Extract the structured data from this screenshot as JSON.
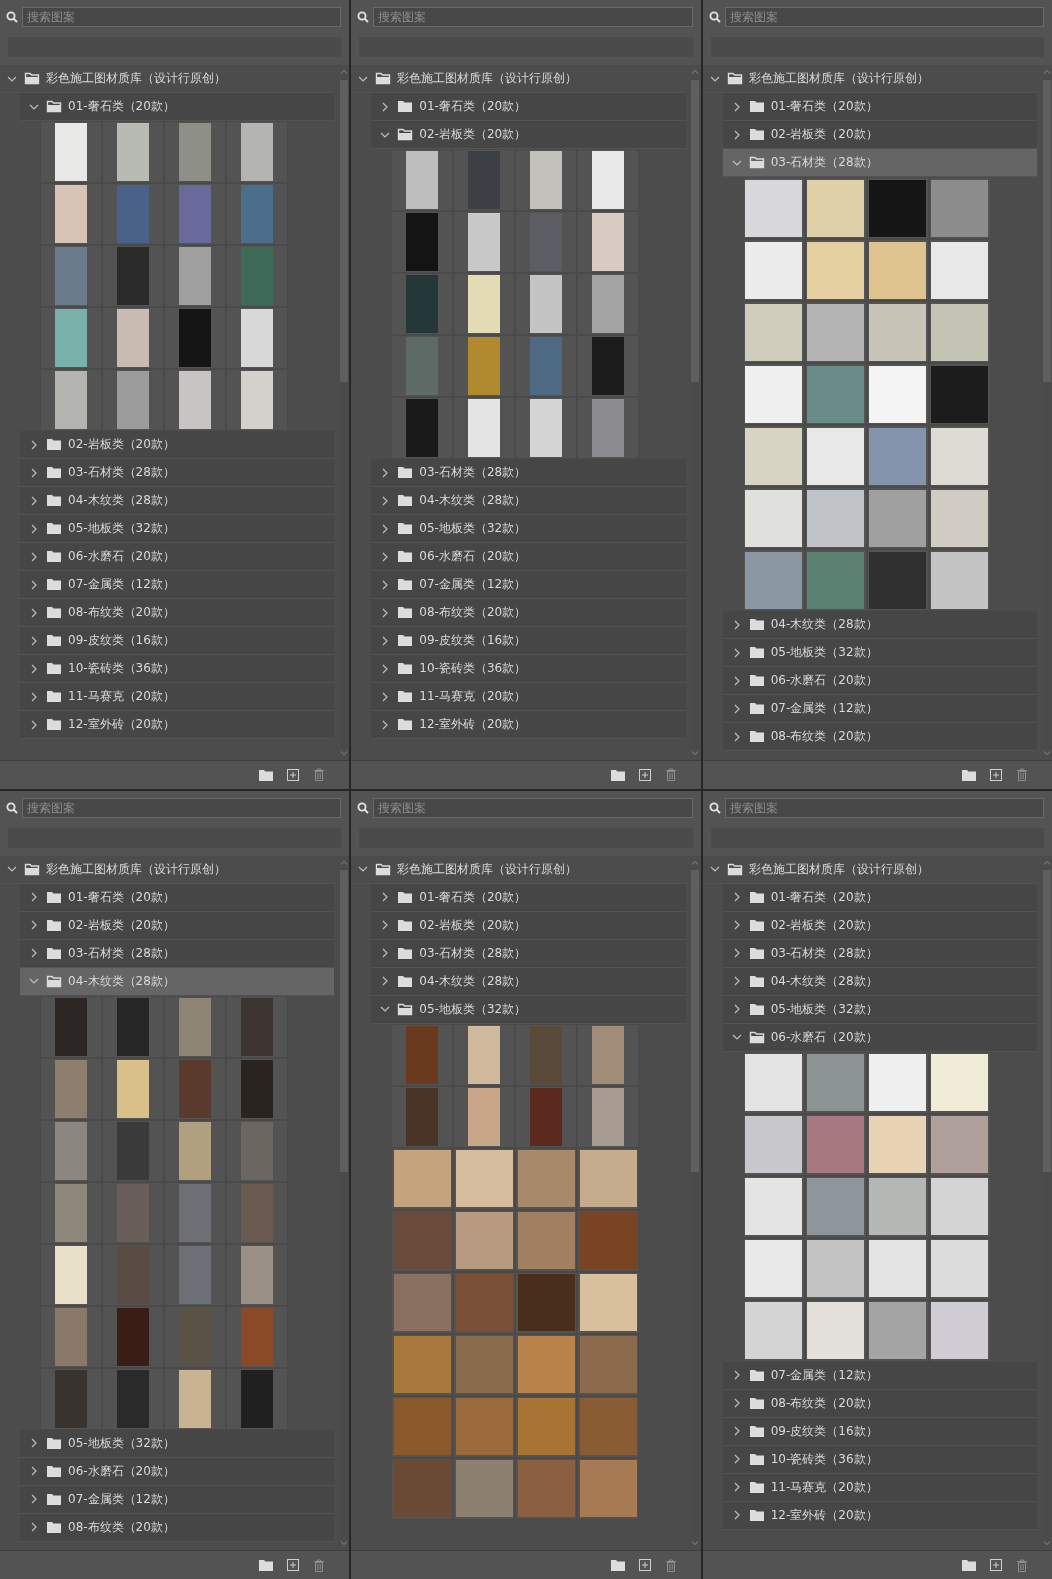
{
  "panels": [
    {
      "search": {
        "placeholder": "搜索图案"
      },
      "tree": {
        "label": "彩色施工图材质库（设计行原创）",
        "expanded": true,
        "children": [
          {
            "label": "01-奢石类（20款）",
            "expanded": true,
            "selected": false,
            "swatch_rows": [
              {
                "kind": "portrait",
                "swatches": [
                  {
                    "color": "#e8e8e6"
                  },
                  {
                    "color": "#b8bab4"
                  },
                  {
                    "color": "#8e9088"
                  },
                  {
                    "color": "#b4b4b0"
                  }
                ]
              },
              {
                "kind": "portrait",
                "swatches": [
                  {
                    "color": "#d8c4b4"
                  },
                  {
                    "color": "#4a6288"
                  },
                  {
                    "color": "#6a6a9a"
                  },
                  {
                    "color": "#4a6e8c"
                  }
                ]
              },
              {
                "kind": "portrait",
                "swatches": [
                  {
                    "color": "#6a7c8c"
                  },
                  {
                    "color": "#2a2a2a"
                  },
                  {
                    "color": "#a0a0a0"
                  },
                  {
                    "color": "#3e6a58"
                  }
                ]
              },
              {
                "kind": "portrait",
                "swatches": [
                  {
                    "color": "#7ab0aa"
                  },
                  {
                    "color": "#c8bcb0"
                  },
                  {
                    "color": "#151515"
                  },
                  {
                    "color": "#d8d8d8"
                  }
                ]
              },
              {
                "kind": "portrait",
                "swatches": [
                  {
                    "color": "#b4b4b0"
                  },
                  {
                    "color": "#9c9c9c"
                  },
                  {
                    "color": "#c8c4c4"
                  },
                  {
                    "color": "#d4d0cc"
                  }
                ]
              }
            ]
          },
          {
            "label": "02-岩板类（20款）",
            "expanded": false,
            "selected": false
          },
          {
            "label": "03-石材类（28款）",
            "expanded": false,
            "selected": false
          },
          {
            "label": "04-木纹类（28款）",
            "expanded": false,
            "selected": false
          },
          {
            "label": "05-地板类（32款）",
            "expanded": false,
            "selected": false
          },
          {
            "label": "06-水磨石（20款）",
            "expanded": false,
            "selected": false
          },
          {
            "label": "07-金属类（12款）",
            "expanded": false,
            "selected": false
          },
          {
            "label": "08-布纹类（20款）",
            "expanded": false,
            "selected": false
          },
          {
            "label": "09-皮纹类（16款）",
            "expanded": false,
            "selected": false
          },
          {
            "label": "10-瓷砖类（36款）",
            "expanded": false,
            "selected": false
          },
          {
            "label": "11-马赛克（20款）",
            "expanded": false,
            "selected": false
          },
          {
            "label": "12-室外砖（20款）",
            "expanded": false,
            "selected": false
          }
        ]
      }
    },
    {
      "search": {
        "placeholder": "搜索图案"
      },
      "tree": {
        "label": "彩色施工图材质库（设计行原创）",
        "expanded": true,
        "children": [
          {
            "label": "01-奢石类（20款）",
            "expanded": false,
            "selected": false
          },
          {
            "label": "02-岩板类（20款）",
            "expanded": true,
            "selected": false,
            "swatch_rows": [
              {
                "kind": "portrait",
                "swatches": [
                  {
                    "color": "#bebebe"
                  },
                  {
                    "color": "#3c4044"
                  },
                  {
                    "color": "#c2c0ba"
                  },
                  {
                    "color": "#e8e8e8"
                  }
                ]
              },
              {
                "kind": "portrait",
                "swatches": [
                  {
                    "color": "#141414"
                  },
                  {
                    "color": "#c8c8c8"
                  },
                  {
                    "color": "#5c5c64"
                  },
                  {
                    "color": "#d8ccc4"
                  }
                ]
              },
              {
                "kind": "portrait",
                "swatches": [
                  {
                    "color": "#24383a"
                  },
                  {
                    "color": "#e4dcb4"
                  },
                  {
                    "color": "#c4c4c4"
                  },
                  {
                    "color": "#a4a4a4"
                  }
                ]
              },
              {
                "kind": "portrait",
                "swatches": [
                  {
                    "color": "#5e6a66"
                  },
                  {
                    "color": "#b08a2c"
                  },
                  {
                    "color": "#4e6a82"
                  },
                  {
                    "color": "#1c1c1c"
                  }
                ]
              },
              {
                "kind": "portrait",
                "swatches": [
                  {
                    "color": "#1a1a1a"
                  },
                  {
                    "color": "#e4e4e4"
                  },
                  {
                    "color": "#d4d4d4"
                  },
                  {
                    "color": "#8c8c90"
                  }
                ]
              }
            ]
          },
          {
            "label": "03-石材类（28款）",
            "expanded": false,
            "selected": false
          },
          {
            "label": "04-木纹类（28款）",
            "expanded": false,
            "selected": false
          },
          {
            "label": "05-地板类（32款）",
            "expanded": false,
            "selected": false
          },
          {
            "label": "06-水磨石（20款）",
            "expanded": false,
            "selected": false
          },
          {
            "label": "07-金属类（12款）",
            "expanded": false,
            "selected": false
          },
          {
            "label": "08-布纹类（20款）",
            "expanded": false,
            "selected": false
          },
          {
            "label": "09-皮纹类（16款）",
            "expanded": false,
            "selected": false
          },
          {
            "label": "10-瓷砖类（36款）",
            "expanded": false,
            "selected": false
          },
          {
            "label": "11-马赛克（20款）",
            "expanded": false,
            "selected": false
          },
          {
            "label": "12-室外砖（20款）",
            "expanded": false,
            "selected": false
          }
        ]
      }
    },
    {
      "search": {
        "placeholder": "搜索图案"
      },
      "tree": {
        "label": "彩色施工图材质库（设计行原创）",
        "expanded": true,
        "children": [
          {
            "label": "01-奢石类（20款）",
            "expanded": false,
            "selected": false
          },
          {
            "label": "02-岩板类（20款）",
            "expanded": false,
            "selected": false
          },
          {
            "label": "03-石材类（28款）",
            "expanded": true,
            "selected": true,
            "swatch_rows": [
              {
                "kind": "square",
                "swatches": [
                  {
                    "color": "#d8d8dc"
                  },
                  {
                    "color": "#e0d0a8"
                  },
                  {
                    "color": "#151515"
                  },
                  {
                    "color": "#8c8c8c"
                  }
                ]
              },
              {
                "kind": "square",
                "swatches": [
                  {
                    "color": "#ececec"
                  },
                  {
                    "color": "#e4d0a0"
                  },
                  {
                    "color": "#e0c490"
                  },
                  {
                    "color": "#e8e8e8"
                  }
                ]
              },
              {
                "kind": "square",
                "swatches": [
                  {
                    "color": "#d0ccbc"
                  },
                  {
                    "color": "#b4b4b4"
                  },
                  {
                    "color": "#c8c4b8"
                  },
                  {
                    "color": "#c4c4b4"
                  }
                ]
              },
              {
                "kind": "square",
                "swatches": [
                  {
                    "color": "#f0f0f0"
                  },
                  {
                    "color": "#6a8c88"
                  },
                  {
                    "color": "#f4f4f4"
                  },
                  {
                    "color": "#1c1c1c"
                  }
                ]
              },
              {
                "kind": "square",
                "swatches": [
                  {
                    "color": "#d8d4c4"
                  },
                  {
                    "color": "#e8e8e8"
                  },
                  {
                    "color": "#8494ac"
                  },
                  {
                    "color": "#dcdcd4"
                  }
                ]
              },
              {
                "kind": "square",
                "swatches": [
                  {
                    "color": "#e0e0dc"
                  },
                  {
                    "color": "#c0c4c8"
                  },
                  {
                    "color": "#a0a0a0"
                  },
                  {
                    "color": "#d0ccc4"
                  }
                ]
              },
              {
                "kind": "square",
                "swatches": [
                  {
                    "color": "#8a96a0"
                  },
                  {
                    "color": "#5a8070"
                  },
                  {
                    "color": "#303030"
                  },
                  {
                    "color": "#c4c4c4"
                  }
                ]
              }
            ]
          },
          {
            "label": "04-木纹类（28款）",
            "expanded": false,
            "selected": false
          },
          {
            "label": "05-地板类（32款）",
            "expanded": false,
            "selected": false
          },
          {
            "label": "06-水磨石（20款）",
            "expanded": false,
            "selected": false
          },
          {
            "label": "07-金属类（12款）",
            "expanded": false,
            "selected": false
          },
          {
            "label": "08-布纹类（20款）",
            "expanded": false,
            "selected": false
          }
        ]
      }
    },
    {
      "search": {
        "placeholder": "搜索图案"
      },
      "tree": {
        "label": "彩色施工图材质库（设计行原创）",
        "expanded": true,
        "children": [
          {
            "label": "01-奢石类（20款）",
            "expanded": false,
            "selected": false
          },
          {
            "label": "02-岩板类（20款）",
            "expanded": false,
            "selected": false
          },
          {
            "label": "03-石材类（28款）",
            "expanded": false,
            "selected": false
          },
          {
            "label": "04-木纹类（28款）",
            "expanded": true,
            "selected": true,
            "swatch_rows": [
              {
                "kind": "portrait",
                "swatches": [
                  {
                    "color": "#2c2624"
                  },
                  {
                    "color": "#262626"
                  },
                  {
                    "color": "#8e8474"
                  },
                  {
                    "color": "#3e3432"
                  }
                ]
              },
              {
                "kind": "portrait",
                "swatches": [
                  {
                    "color": "#8e7e6e"
                  },
                  {
                    "color": "#d8c088"
                  },
                  {
                    "color": "#5a3a2c"
                  },
                  {
                    "color": "#2a2420"
                  }
                ]
              },
              {
                "kind": "portrait",
                "swatches": [
                  {
                    "color": "#8c8680"
                  },
                  {
                    "color": "#3a3a3a"
                  },
                  {
                    "color": "#b0a080"
                  },
                  {
                    "color": "#6c6660"
                  }
                ]
              },
              {
                "kind": "portrait",
                "swatches": [
                  {
                    "color": "#8e887a"
                  },
                  {
                    "color": "#6a5e58"
                  },
                  {
                    "color": "#6e7076"
                  },
                  {
                    "color": "#6a5a50"
                  }
                ]
              },
              {
                "kind": "portrait",
                "swatches": [
                  {
                    "color": "#e8e0c8"
                  },
                  {
                    "color": "#5a4c44"
                  },
                  {
                    "color": "#6e7078"
                  },
                  {
                    "color": "#9a9088"
                  }
                ]
              },
              {
                "kind": "portrait",
                "swatches": [
                  {
                    "color": "#8a7868"
                  },
                  {
                    "color": "#3a1e16"
                  },
                  {
                    "color": "#5a5244"
                  },
                  {
                    "color": "#8a4a28"
                  }
                ]
              },
              {
                "kind": "portrait",
                "swatches": [
                  {
                    "color": "#3a3430"
                  },
                  {
                    "color": "#2a2a2a"
                  },
                  {
                    "color": "#c8b490"
                  },
                  {
                    "color": "#202020"
                  }
                ]
              }
            ]
          },
          {
            "label": "05-地板类（32款）",
            "expanded": false,
            "selected": false
          },
          {
            "label": "06-水磨石（20款）",
            "expanded": false,
            "selected": false
          },
          {
            "label": "07-金属类（12款）",
            "expanded": false,
            "selected": false
          },
          {
            "label": "08-布纹类（20款）",
            "expanded": false,
            "selected": false
          }
        ]
      }
    },
    {
      "search": {
        "placeholder": "搜索图案"
      },
      "tree": {
        "label": "彩色施工图材质库（设计行原创）",
        "expanded": true,
        "children": [
          {
            "label": "01-奢石类（20款）",
            "expanded": false,
            "selected": false
          },
          {
            "label": "02-岩板类（20款）",
            "expanded": false,
            "selected": false
          },
          {
            "label": "03-石材类（28款）",
            "expanded": false,
            "selected": false
          },
          {
            "label": "04-木纹类（28款）",
            "expanded": false,
            "selected": false
          },
          {
            "label": "05-地板类（32款）",
            "expanded": true,
            "selected": false,
            "swatch_rows": [
              {
                "kind": "portrait",
                "swatches": [
                  {
                    "color": "#6a3a1e"
                  },
                  {
                    "color": "#d0b89c"
                  },
                  {
                    "color": "#5a4a3a"
                  },
                  {
                    "color": "#a08c78"
                  }
                ]
              },
              {
                "kind": "portrait",
                "swatches": [
                  {
                    "color": "#4a3428"
                  },
                  {
                    "color": "#c8a888"
                  },
                  {
                    "color": "#5a2a1e"
                  },
                  {
                    "color": "#a89c90"
                  }
                ]
              },
              {
                "kind": "square",
                "swatches": [
                  {
                    "color": "#c4a47c"
                  },
                  {
                    "color": "#d4bc9c"
                  },
                  {
                    "color": "#a88a6a"
                  },
                  {
                    "color": "#c4ac8c"
                  }
                ]
              },
              {
                "kind": "square",
                "swatches": [
                  {
                    "color": "#6a4a3a"
                  },
                  {
                    "color": "#b89a80"
                  },
                  {
                    "color": "#a08060"
                  },
                  {
                    "color": "#7a4424"
                  }
                ]
              },
              {
                "kind": "square",
                "swatches": [
                  {
                    "color": "#8a7060"
                  },
                  {
                    "color": "#7a5036"
                  },
                  {
                    "color": "#4a2e1c"
                  },
                  {
                    "color": "#d8c09c"
                  }
                ]
              },
              {
                "kind": "square",
                "swatches": [
                  {
                    "color": "#a8783c"
                  },
                  {
                    "color": "#8a6c4c"
                  },
                  {
                    "color": "#b8844c"
                  },
                  {
                    "color": "#8c6a4c"
                  }
                ]
              },
              {
                "kind": "square",
                "swatches": [
                  {
                    "color": "#8a5a2c"
                  },
                  {
                    "color": "#9a6a3c"
                  },
                  {
                    "color": "#a87434"
                  },
                  {
                    "color": "#8a5c34"
                  }
                ]
              },
              {
                "kind": "square",
                "swatches": [
                  {
                    "color": "#6a4a34"
                  },
                  {
                    "color": "#8c8070"
                  },
                  {
                    "color": "#8a6040"
                  },
                  {
                    "color": "#a87a54"
                  }
                ]
              }
            ]
          }
        ]
      }
    },
    {
      "search": {
        "placeholder": "搜索图案"
      },
      "tree": {
        "label": "彩色施工图材质库（设计行原创）",
        "expanded": true,
        "children": [
          {
            "label": "01-奢石类（20款）",
            "expanded": false,
            "selected": false
          },
          {
            "label": "02-岩板类（20款）",
            "expanded": false,
            "selected": false
          },
          {
            "label": "03-石材类（28款）",
            "expanded": false,
            "selected": false
          },
          {
            "label": "04-木纹类（28款）",
            "expanded": false,
            "selected": false
          },
          {
            "label": "05-地板类（32款）",
            "expanded": false,
            "selected": false
          },
          {
            "label": "06-水磨石（20款）",
            "expanded": true,
            "selected": false,
            "swatch_rows": [
              {
                "kind": "square",
                "swatches": [
                  {
                    "color": "#e4e4e4"
                  },
                  {
                    "color": "#8c9494"
                  },
                  {
                    "color": "#f0f0f0"
                  },
                  {
                    "color": "#f0ecd8"
                  }
                ]
              },
              {
                "kind": "square",
                "swatches": [
                  {
                    "color": "#c8c8cc"
                  },
                  {
                    "color": "#a87880"
                  },
                  {
                    "color": "#e8d4b4"
                  },
                  {
                    "color": "#b0a09c"
                  }
                ]
              },
              {
                "kind": "square",
                "swatches": [
                  {
                    "color": "#e4e4e4"
                  },
                  {
                    "color": "#8e969c"
                  },
                  {
                    "color": "#b4b8b4"
                  },
                  {
                    "color": "#d4d4d4"
                  }
                ]
              },
              {
                "kind": "square",
                "swatches": [
                  {
                    "color": "#e8e8e8"
                  },
                  {
                    "color": "#c4c4c4"
                  },
                  {
                    "color": "#e4e4e4"
                  },
                  {
                    "color": "#dcdcdc"
                  }
                ]
              },
              {
                "kind": "square",
                "swatches": [
                  {
                    "color": "#d4d4d4"
                  },
                  {
                    "color": "#e4e0dc"
                  },
                  {
                    "color": "#a4a4a4"
                  },
                  {
                    "color": "#d0ccd4"
                  }
                ]
              }
            ]
          },
          {
            "label": "07-金属类（12款）",
            "expanded": false,
            "selected": false
          },
          {
            "label": "08-布纹类（20款）",
            "expanded": false,
            "selected": false
          },
          {
            "label": "09-皮纹类（16款）",
            "expanded": false,
            "selected": false
          },
          {
            "label": "10-瓷砖类（36款）",
            "expanded": false,
            "selected": false
          },
          {
            "label": "11-马赛克（20款）",
            "expanded": false,
            "selected": false
          },
          {
            "label": "12-室外砖（20款）",
            "expanded": false,
            "selected": false
          }
        ]
      }
    }
  ]
}
